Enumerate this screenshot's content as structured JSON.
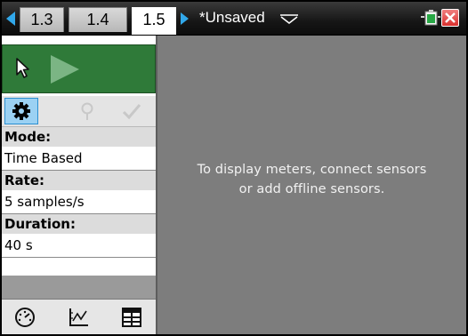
{
  "tabs": [
    {
      "label": "1.3",
      "active": false
    },
    {
      "label": "1.4",
      "active": false
    },
    {
      "label": "1.5",
      "active": true
    }
  ],
  "document": {
    "title": "*Unsaved"
  },
  "icons": {
    "prev_tabs": "left-arrow-icon",
    "next_tabs": "right-arrow-icon",
    "doc_menu": "chevron-down-icon",
    "battery": "battery-icon",
    "close": "close-icon",
    "pointer": "pointer-icon",
    "play": "play-icon",
    "settings": "gear-icon",
    "marker": "marker-icon",
    "check": "check-icon",
    "meter": "meter-view-icon",
    "graph": "graph-view-icon",
    "table": "table-view-icon"
  },
  "colors": {
    "accent": "#31a8ea",
    "run_bar": "#2f7a39",
    "main_bg": "#7d7d7d",
    "label_bg": "#dcdcdc",
    "close_red": "#d9302e"
  },
  "settings": {
    "mode_label": "Mode:",
    "mode_value": "Time Based",
    "rate_label": "Rate:",
    "rate_value": "5 samples/s",
    "duration_label": "Duration:",
    "duration_value": "40 s"
  },
  "main": {
    "message_line1": "To display meters, connect sensors",
    "message_line2": "or add offline sensors."
  }
}
